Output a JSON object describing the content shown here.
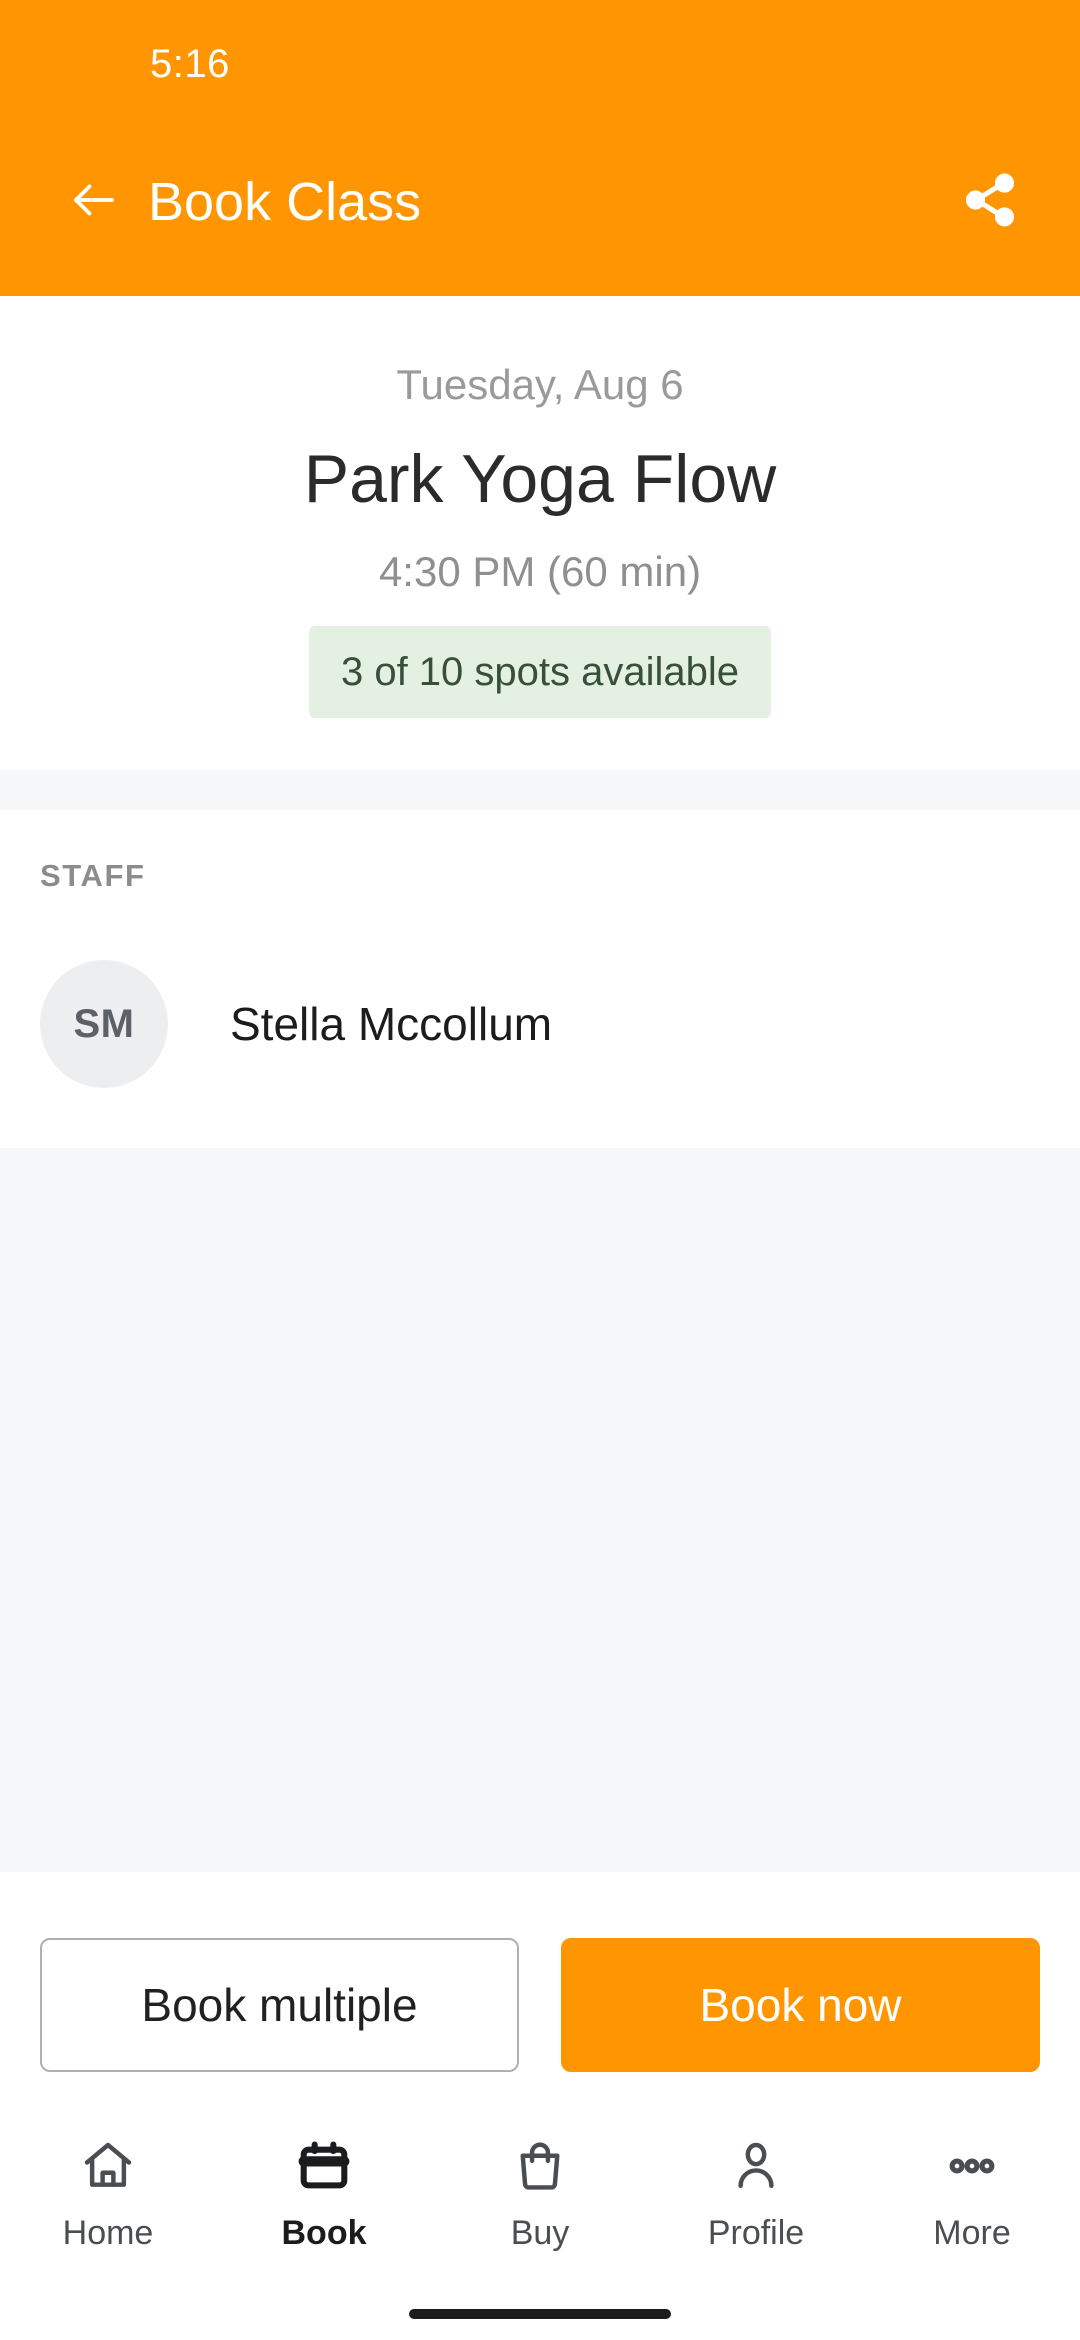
{
  "status_bar": {
    "clock": "5:16"
  },
  "app_bar": {
    "title": "Book Class",
    "back_icon": "arrow-left-icon",
    "share_icon": "share-icon",
    "background_color": "#FF9500",
    "text_color": "#FFFFFF"
  },
  "class_summary": {
    "date": "Tuesday, Aug 6",
    "name": "Park Yoga Flow",
    "time": "4:30 PM (60 min)",
    "availability": "3 of 10 spots available",
    "availability_bg": "#E3F0E2",
    "availability_text_color": "#37503A"
  },
  "staff_section": {
    "label": "STAFF",
    "members": [
      {
        "initials": "SM",
        "name": "Stella Mccollum"
      }
    ]
  },
  "actions": {
    "secondary_label": "Book multiple",
    "primary_label": "Book now",
    "primary_bg": "#FF9500"
  },
  "bottom_nav": {
    "items": [
      {
        "label": "Home",
        "icon": "home-icon",
        "active": false
      },
      {
        "label": "Book",
        "icon": "calendar-icon",
        "active": true
      },
      {
        "label": "Buy",
        "icon": "shopping-bag-icon",
        "active": false
      },
      {
        "label": "Profile",
        "icon": "person-icon",
        "active": false
      },
      {
        "label": "More",
        "icon": "more-dots-icon",
        "active": false
      }
    ]
  }
}
